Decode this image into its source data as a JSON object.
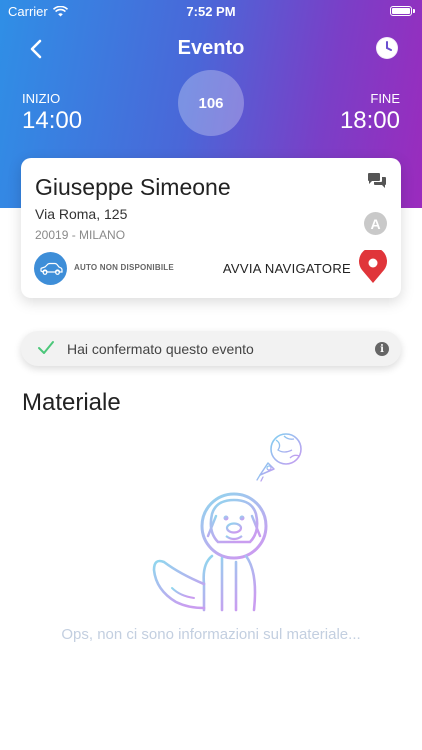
{
  "status_bar": {
    "carrier": "Carrier",
    "time": "7:52 PM"
  },
  "nav": {
    "title": "Evento",
    "back_icon": "chevron-left-icon",
    "history_icon": "clock-icon"
  },
  "event": {
    "start_label": "INIZIO",
    "start_time": "14:00",
    "end_label": "FINE",
    "end_time": "18:00",
    "code": "106"
  },
  "customer": {
    "name": "Giuseppe Simeone",
    "address": "Via Roma, 125",
    "city": "20019 - MILANO",
    "badge_letter": "A",
    "car_status": "AUTO NON DISPONIBILE",
    "navigate_label": "AVVIA NAVIGATORE"
  },
  "confirmation": {
    "text": "Hai confermato questo evento",
    "info_symbol": "i"
  },
  "materials": {
    "title": "Materiale",
    "empty_message": "Ops, non ci sono informazioni sul materiale..."
  },
  "colors": {
    "gradient_start": "#2f8fe6",
    "gradient_end": "#9b2bbd",
    "car_button": "#3e8ed8",
    "navigate_pin": "#e0353a",
    "confirm_check": "#4cc77a"
  }
}
